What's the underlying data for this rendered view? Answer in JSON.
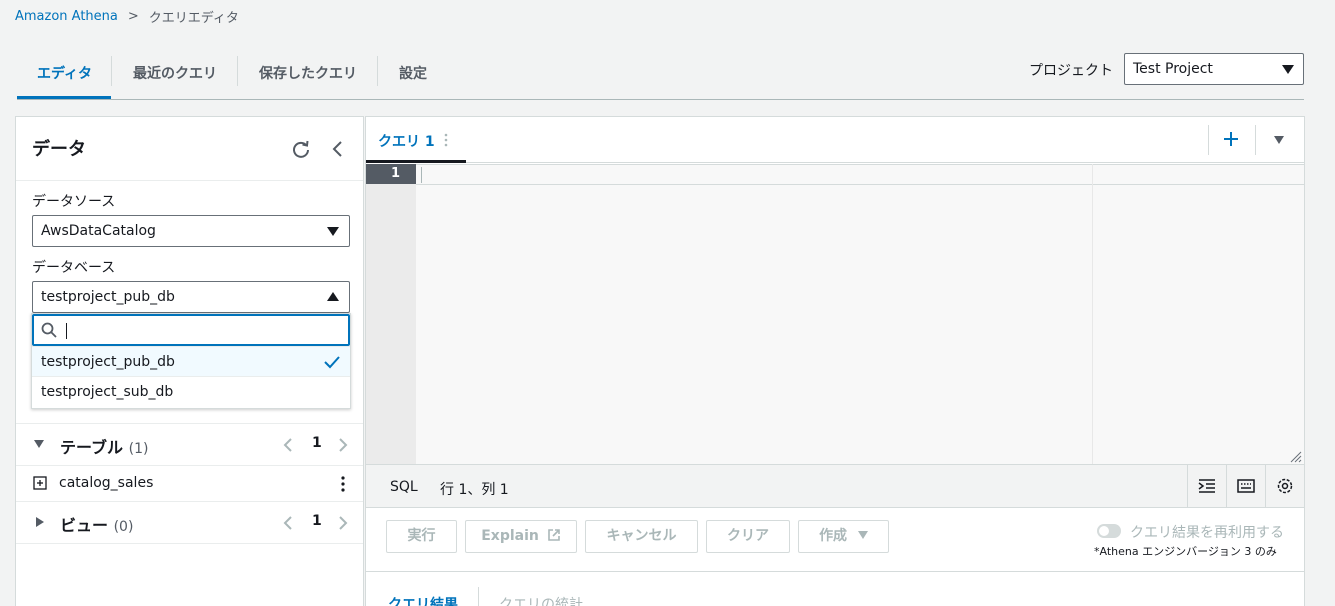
{
  "breadcrumb": {
    "root": "Amazon Athena",
    "separator": ">",
    "current": "クエリエディタ"
  },
  "tabs": [
    {
      "label": "エディタ",
      "active": true
    },
    {
      "label": "最近のクエリ",
      "active": false
    },
    {
      "label": "保存したクエリ",
      "active": false
    },
    {
      "label": "設定",
      "active": false
    }
  ],
  "project": {
    "label": "プロジェクト",
    "value": "Test Project"
  },
  "data_panel": {
    "title": "データ",
    "data_source_label": "データソース",
    "data_source_value": "AwsDataCatalog",
    "database_label": "データベース",
    "database_value": "testproject_pub_db",
    "dropdown_options": [
      "testproject_pub_db",
      "testproject_sub_db"
    ],
    "tables": {
      "title": "テーブル",
      "count": "(1)",
      "page": "1",
      "items": [
        "catalog_sales"
      ]
    },
    "views": {
      "title": "ビュー",
      "count": "(0)",
      "page": "1"
    }
  },
  "editor": {
    "tab_label": "クエリ 1",
    "line_number": "1",
    "language": "SQL",
    "cursor_pos": "行 1、列 1",
    "buttons": {
      "run": "実行",
      "explain": "Explain",
      "cancel": "キャンセル",
      "clear": "クリア",
      "create": "作成"
    },
    "reuse_label": "クエリ結果を再利用する",
    "reuse_note": "*Athena エンジンバージョン 3 のみ",
    "results_tabs": [
      "クエリ結果",
      "クエリの統計"
    ]
  },
  "colors": {
    "accent": "#0073bb",
    "text": "#16191f",
    "disabled": "#aab7b8"
  }
}
